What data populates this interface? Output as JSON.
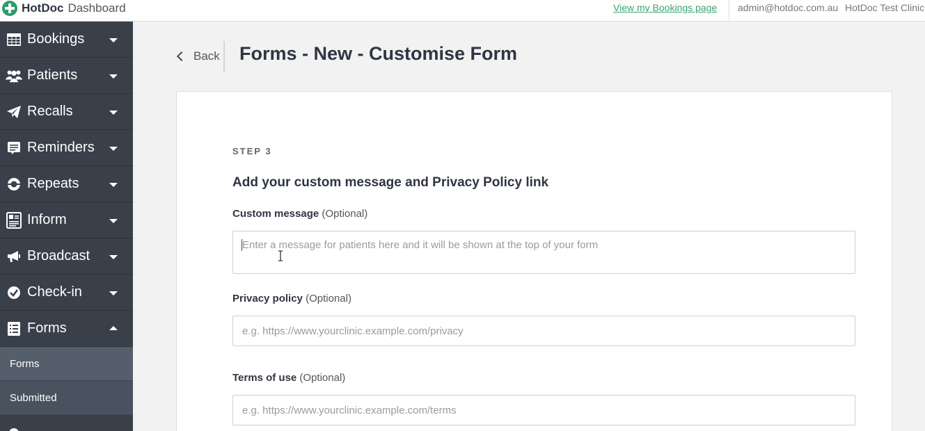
{
  "topbar": {
    "brand": "HotDoc",
    "app_name": "Dashboard",
    "bookings_link": "View my Bookings page",
    "user_email": "admin@hotdoc.com.au",
    "clinic_name": "HotDoc Test Clinic",
    "brand_color": "#2e9b6a"
  },
  "sidebar": {
    "items": [
      {
        "label": "Bookings",
        "icon": "table-icon"
      },
      {
        "label": "Patients",
        "icon": "users-icon"
      },
      {
        "label": "Recalls",
        "icon": "paper-plane-icon"
      },
      {
        "label": "Reminders",
        "icon": "reminders-icon"
      },
      {
        "label": "Repeats",
        "icon": "repeat-icon"
      },
      {
        "label": "Inform",
        "icon": "document-icon"
      },
      {
        "label": "Broadcast",
        "icon": "megaphone-icon"
      },
      {
        "label": "Check-in",
        "icon": "check-circle-icon"
      },
      {
        "label": "Forms",
        "icon": "list-icon",
        "expanded": true
      }
    ],
    "forms_subitems": [
      {
        "label": "Forms",
        "active": true
      },
      {
        "label": "Submitted",
        "active": false
      }
    ]
  },
  "header": {
    "back_label": "Back",
    "title": "Forms - New - Customise Form"
  },
  "form": {
    "step": "STEP 3",
    "section_title": "Add your custom message and Privacy Policy link",
    "custom_message": {
      "label": "Custom message",
      "optional": "(Optional)",
      "placeholder": "Enter a message for patients here and it will be shown at the top of your form",
      "value": ""
    },
    "privacy_policy": {
      "label": "Privacy policy",
      "optional": "(Optional)",
      "placeholder": "e.g. https://www.yourclinic.example.com/privacy",
      "value": ""
    },
    "terms_of_use": {
      "label": "Terms of use",
      "optional": "(Optional)",
      "placeholder": "e.g. https://www.yourclinic.example.com/terms",
      "value": ""
    }
  }
}
